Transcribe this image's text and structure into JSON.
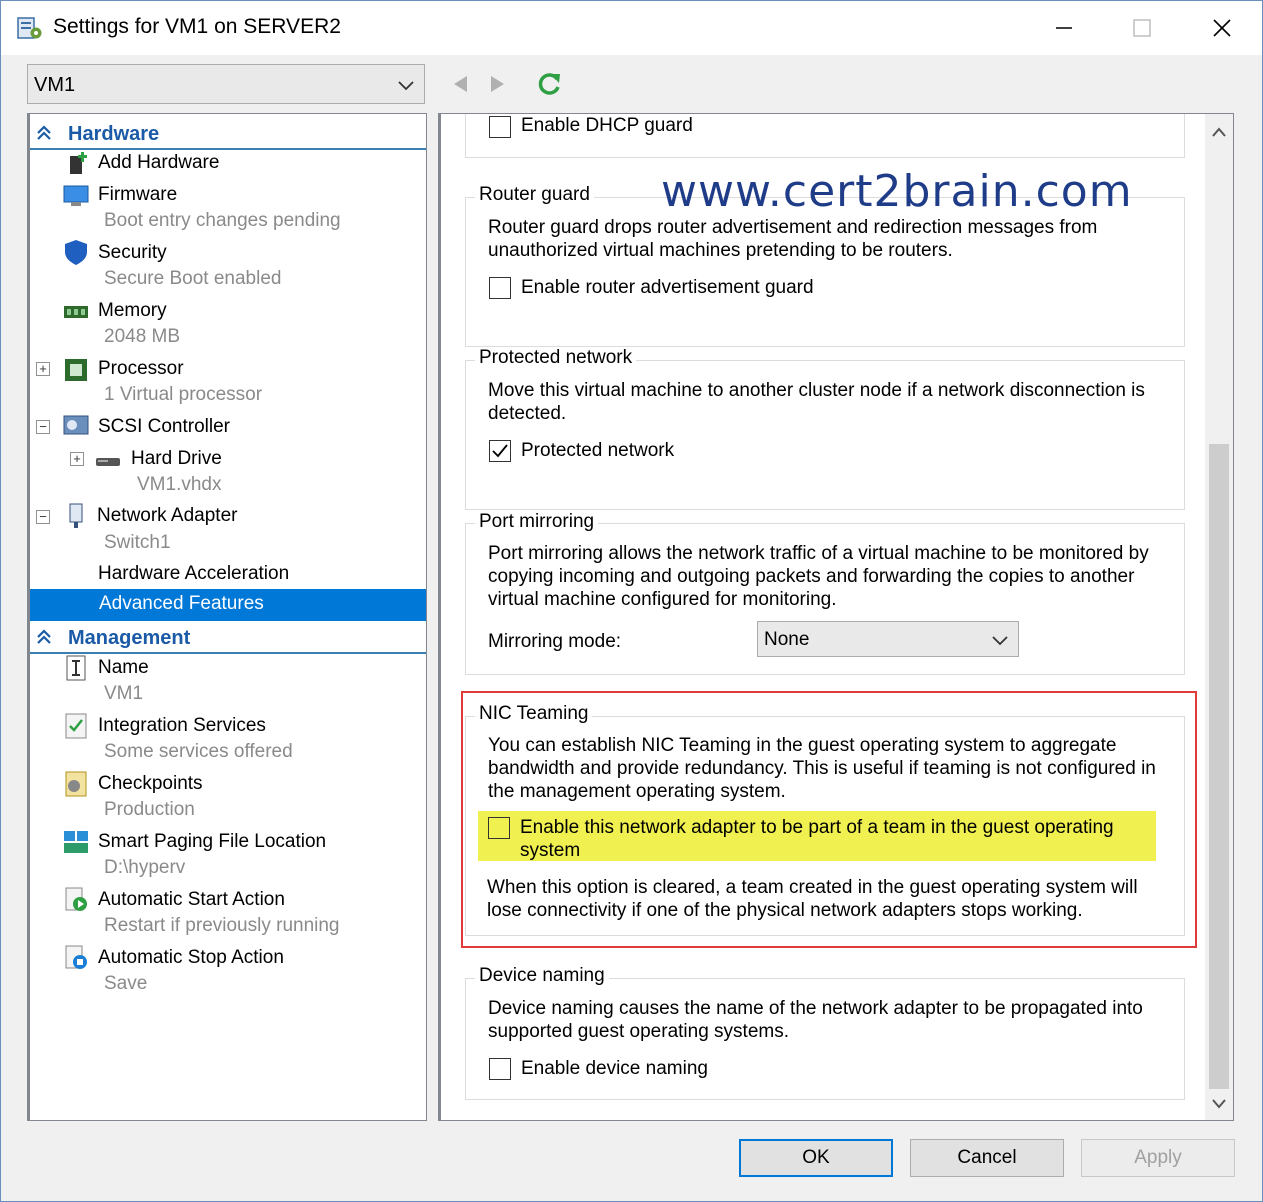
{
  "window": {
    "title": "Settings for VM1 on SERVER2",
    "controls": {
      "minimize": "minimize-icon",
      "maximize": "maximize-icon",
      "close": "close-icon"
    }
  },
  "toolbar": {
    "vm_selected": "VM1",
    "back_icon": "back-arrow-icon",
    "forward_icon": "forward-arrow-icon",
    "refresh_icon": "refresh-icon"
  },
  "hardware": {
    "header": "Hardware",
    "add_hardware": "Add Hardware",
    "firmware": "Firmware",
    "firmware_sub": "Boot entry changes pending",
    "security": "Security",
    "security_sub": "Secure Boot enabled",
    "memory": "Memory",
    "memory_sub": "2048 MB",
    "processor": "Processor",
    "processor_sub": "1 Virtual processor",
    "scsi": "SCSI Controller",
    "hard_drive": "Hard Drive",
    "hard_drive_sub": "VM1.vhdx",
    "network_adapter": "Network Adapter",
    "network_adapter_sub": "Switch1",
    "hw_accel": "Hardware Acceleration",
    "advanced": "Advanced Features"
  },
  "management": {
    "header": "Management",
    "name": "Name",
    "name_sub": "VM1",
    "integration": "Integration Services",
    "integration_sub": "Some services offered",
    "checkpoints": "Checkpoints",
    "checkpoints_sub": "Production",
    "paging": "Smart Paging File Location",
    "paging_sub": "D:\\hyperv",
    "auto_start": "Automatic Start Action",
    "auto_start_sub": "Restart if previously running",
    "auto_stop": "Automatic Stop Action",
    "auto_stop_sub": "Save"
  },
  "content": {
    "dhcp_guard": {
      "label": "Enable DHCP guard",
      "checked": false
    },
    "router_guard": {
      "title": "Router guard",
      "desc1": "Router guard drops router advertisement and redirection messages from",
      "desc2": "unauthorized virtual machines pretending to be routers.",
      "checkbox": "Enable router advertisement guard",
      "checked": false
    },
    "protected_network": {
      "title": "Protected network",
      "desc1": "Move this virtual machine to another cluster node if a network disconnection is",
      "desc2": "detected.",
      "checkbox": "Protected network",
      "checked": true
    },
    "port_mirroring": {
      "title": "Port mirroring",
      "desc1": "Port mirroring allows the network traffic of a virtual machine to be monitored by",
      "desc2": "copying incoming and outgoing packets and forwarding the copies to another",
      "desc3": "virtual machine configured for monitoring.",
      "mode_label": "Mirroring mode:",
      "mode_value": "None"
    },
    "nic_teaming": {
      "title": "NIC Teaming",
      "desc1": "You can establish NIC Teaming in the guest operating system to aggregate",
      "desc2": "bandwidth and provide redundancy. This is useful if teaming is not configured in",
      "desc3": "the management operating system.",
      "checkbox1": "Enable this network adapter to be part of a team in the guest operating",
      "checkbox2": "system",
      "checked": false,
      "note1": "When this option is cleared, a team created in the guest operating system will",
      "note2": "lose connectivity if one of the physical network adapters stops working."
    },
    "device_naming": {
      "title": "Device naming",
      "desc1": "Device naming causes the name of the network adapter to be propagated into",
      "desc2": "supported guest operating systems.",
      "checkbox": "Enable device naming",
      "checked": false
    }
  },
  "watermark": "www.cert2brain.com",
  "buttons": {
    "ok": "OK",
    "cancel": "Cancel",
    "apply": "Apply"
  },
  "colors": {
    "selection": "#0078d7",
    "highlight_red": "#e03b3b",
    "highlight_yellow": "#f0f050",
    "section_header": "#1a5aa6"
  }
}
